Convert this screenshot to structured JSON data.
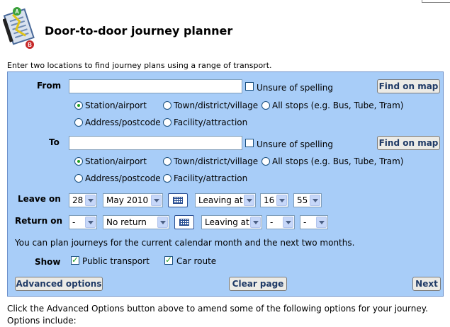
{
  "page": {
    "title": "Door-to-door journey planner",
    "intro": "Enter two locations to find journey plans using a range of transport."
  },
  "from": {
    "label": "From",
    "value": "",
    "unsure": "Unsure of spelling",
    "find_map": "Find on map",
    "types": [
      "Station/airport",
      "Town/district/village",
      "All stops (e.g. Bus, Tube, Tram)",
      "Address/postcode",
      "Facility/attraction"
    ],
    "selected": "Station/airport"
  },
  "to": {
    "label": "To",
    "value": "",
    "unsure": "Unsure of spelling",
    "find_map": "Find on map",
    "types": [
      "Station/airport",
      "Town/district/village",
      "All stops (e.g. Bus, Tube, Tram)",
      "Address/postcode",
      "Facility/attraction"
    ],
    "selected": "Station/airport"
  },
  "leave": {
    "label": "Leave on",
    "day": "28",
    "month": "May 2010",
    "mode": "Leaving at",
    "hour": "16",
    "minute": "55"
  },
  "return": {
    "label": "Return on",
    "day": "-",
    "month": "No return",
    "mode": "Leaving at",
    "hour": "-",
    "minute": "-"
  },
  "note": "You can plan journeys for the current calendar month and the next two months.",
  "show": {
    "label": "Show",
    "public_transport": "Public transport",
    "car_route": "Car route",
    "public_checked": true,
    "car_checked": true
  },
  "buttons": {
    "advanced": "Advanced options",
    "clear": "Clear page",
    "next": "Next"
  },
  "footer_text": "Click the Advanced Options button above to amend some of the following options for your journey. Options include:",
  "colors": {
    "panel_bg": "#a8cdf8",
    "panel_border": "#6b8fc9",
    "check_green": "#21a121",
    "button_text": "#1f3a66"
  }
}
